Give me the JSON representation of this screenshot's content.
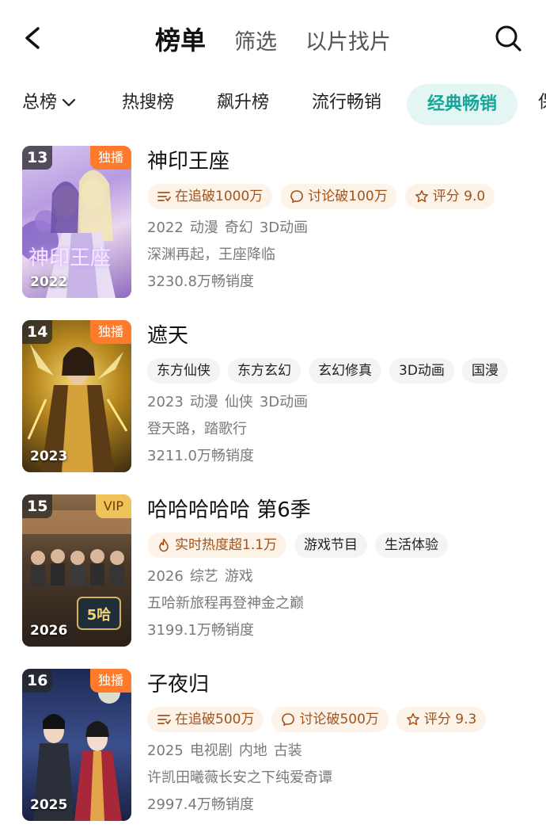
{
  "header": {
    "tabs": [
      "榜单",
      "筛选",
      "以片找片"
    ],
    "active_tab": 0
  },
  "categories": [
    {
      "label": "总榜",
      "has_dropdown": true
    },
    {
      "label": "热搜榜"
    },
    {
      "label": "飙升榜"
    },
    {
      "label": "流行畅销"
    },
    {
      "label": "经典畅销",
      "active": true
    },
    {
      "label": "保"
    }
  ],
  "colors": {
    "accent": "#18a59a",
    "accent_bg": "#e3f6f4",
    "hot_chip_bg": "#fdf3e8",
    "hot_chip_text": "#a3521a",
    "exclusive_badge": "#ff7a2a",
    "vip_badge": "#f0c25a"
  },
  "items": [
    {
      "rank": "13",
      "badge": "独播",
      "badge_type": "exclusive",
      "poster_year": "2022",
      "poster_art_text": "神印王座",
      "title": "神印王座",
      "chips": [
        {
          "icon": "list-icon",
          "text": "在追破1000万",
          "style": "hot"
        },
        {
          "icon": "comment-icon",
          "text": "讨论破100万",
          "style": "hot"
        },
        {
          "icon": "star-icon",
          "text": "评分 9.0",
          "style": "hot"
        }
      ],
      "meta": [
        "2022",
        "动漫",
        "奇幻",
        "3D动画"
      ],
      "desc": "深渊再起，王座降临",
      "sales": "3230.8万畅销度"
    },
    {
      "rank": "14",
      "badge": "独播",
      "badge_type": "exclusive",
      "poster_year": "2023",
      "title": "遮天",
      "chips": [
        {
          "text": "东方仙侠",
          "style": "tag"
        },
        {
          "text": "东方玄幻",
          "style": "tag"
        },
        {
          "text": "玄幻修真",
          "style": "tag"
        },
        {
          "text": "3D动画",
          "style": "tag"
        },
        {
          "text": "国漫",
          "style": "tag"
        }
      ],
      "meta": [
        "2023",
        "动漫",
        "仙侠",
        "3D动画"
      ],
      "desc": "登天路，踏歌行",
      "sales": "3211.0万畅销度"
    },
    {
      "rank": "15",
      "badge": "VIP",
      "badge_type": "vip",
      "poster_year": "2026",
      "title": "哈哈哈哈哈 第6季",
      "chips": [
        {
          "icon": "flame-icon",
          "text": "实时热度超1.1万",
          "style": "hot"
        },
        {
          "text": "游戏节目",
          "style": "tag"
        },
        {
          "text": "生活体验",
          "style": "tag"
        }
      ],
      "meta": [
        "2026",
        "综艺",
        "游戏"
      ],
      "desc": "五哈新旅程再登神金之巅",
      "sales": "3199.1万畅销度"
    },
    {
      "rank": "16",
      "badge": "独播",
      "badge_type": "exclusive",
      "poster_year": "2025",
      "title": "子夜归",
      "chips": [
        {
          "icon": "list-icon",
          "text": "在追破500万",
          "style": "hot"
        },
        {
          "icon": "comment-icon",
          "text": "讨论破500万",
          "style": "hot"
        },
        {
          "icon": "star-icon",
          "text": "评分 9.3",
          "style": "hot"
        }
      ],
      "meta": [
        "2025",
        "电视剧",
        "内地",
        "古装"
      ],
      "desc": "许凯田曦薇长安之下纯爱奇谭",
      "sales": "2997.4万畅销度"
    }
  ]
}
